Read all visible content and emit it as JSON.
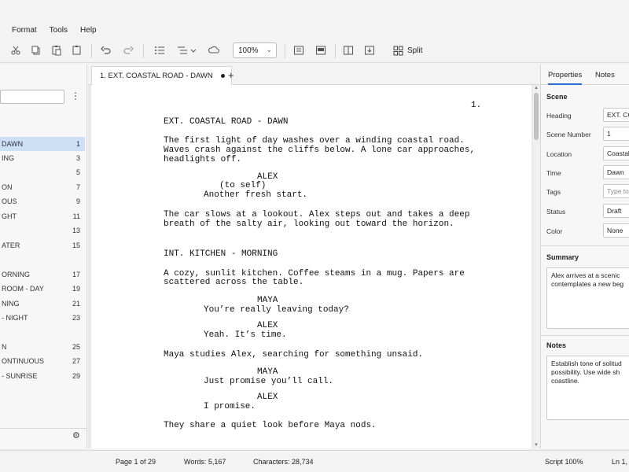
{
  "menu": [
    "Format",
    "Tools",
    "Help"
  ],
  "toolbar": {
    "zoom": "100%",
    "split_label": "Split"
  },
  "sidebar": {
    "items": [
      {
        "label": "DAWN",
        "num": "1",
        "selected": true
      },
      {
        "label": "ING",
        "num": "3"
      },
      {
        "label": "",
        "num": "5"
      },
      {
        "label": "ON",
        "num": "7"
      },
      {
        "label": "OUS",
        "num": "9"
      },
      {
        "label": "GHT",
        "num": "11"
      },
      {
        "label": "",
        "num": "13"
      },
      {
        "label": "ATER",
        "num": "15"
      },
      {
        "label": "ORNING",
        "num": "17"
      },
      {
        "label": "ROOM - DAY",
        "num": "19"
      },
      {
        "label": "NING",
        "num": "21"
      },
      {
        "label": "- NIGHT",
        "num": "23"
      },
      {
        "label": "N",
        "num": "25"
      },
      {
        "label": "ONTINUOUS",
        "num": "27"
      },
      {
        "label": "- SUNRISE",
        "num": "29"
      }
    ]
  },
  "tab": {
    "title": "1. EXT. COASTAL ROAD - DAWN"
  },
  "script": {
    "page_number": "1.",
    "lines": [
      "EXT. COASTAL ROAD - DAWN",
      "The first light of day washes over a winding coastal road.",
      "Waves crash against the cliffs below. A lone car approaches,",
      "headlights off.",
      "ALEX",
      "(to self)",
      "Another fresh start.",
      "The car slows at a lookout. Alex steps out and takes a deep",
      "breath of the salty air, looking out toward the horizon.",
      "INT. KITCHEN - MORNING",
      "A cozy, sunlit kitchen. Coffee steams in a mug. Papers are",
      "scattered across the table.",
      "MAYA",
      "You’re really leaving today?",
      "ALEX",
      "Yeah. It’s time.",
      "Maya studies Alex, searching for something unsaid.",
      "MAYA",
      "Just promise you’ll call.",
      "ALEX",
      "I promise.",
      "They share a quiet look before Maya nods."
    ]
  },
  "props": {
    "tabs": [
      "Properties",
      "Notes"
    ],
    "scene_section": "Scene",
    "fields": [
      {
        "label": "Heading",
        "value": "EXT. CO",
        "placeholder": false
      },
      {
        "label": "Scene Number",
        "value": "1",
        "placeholder": false
      },
      {
        "label": "Location",
        "value": "Coastal",
        "placeholder": false
      },
      {
        "label": "Time",
        "value": "Dawn",
        "placeholder": false
      },
      {
        "label": "Tags",
        "value": "Type to",
        "placeholder": true
      },
      {
        "label": "Status",
        "value": "Draft",
        "placeholder": false
      },
      {
        "label": "Color",
        "value": "None",
        "placeholder": false
      }
    ],
    "summary_label": "Summary",
    "summary_lines": [
      "Alex arrives at a scenic",
      "contemplates a new beg"
    ],
    "notes_label": "Notes",
    "notes_lines": [
      "Establish tone of solitud",
      "possibility. Use wide sh",
      "coastline."
    ]
  },
  "status": {
    "page": "Page 1 of 29",
    "words": "Words: 5,167",
    "chars": "Characters: 28,734",
    "script": "Script 100%",
    "ln": "Ln 1, "
  }
}
